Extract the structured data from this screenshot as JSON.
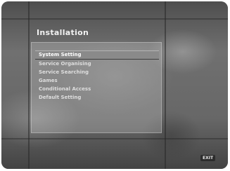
{
  "screen": {
    "title": "Installation",
    "badge": "EXIT"
  },
  "menu": {
    "items": [
      {
        "label": "System Setting",
        "selected": true
      },
      {
        "label": "Service Organising",
        "selected": false
      },
      {
        "label": "Service Searching",
        "selected": false
      },
      {
        "label": "Games",
        "selected": false
      },
      {
        "label": "Conditional Access",
        "selected": false
      },
      {
        "label": "Default Setting",
        "selected": false
      }
    ]
  }
}
